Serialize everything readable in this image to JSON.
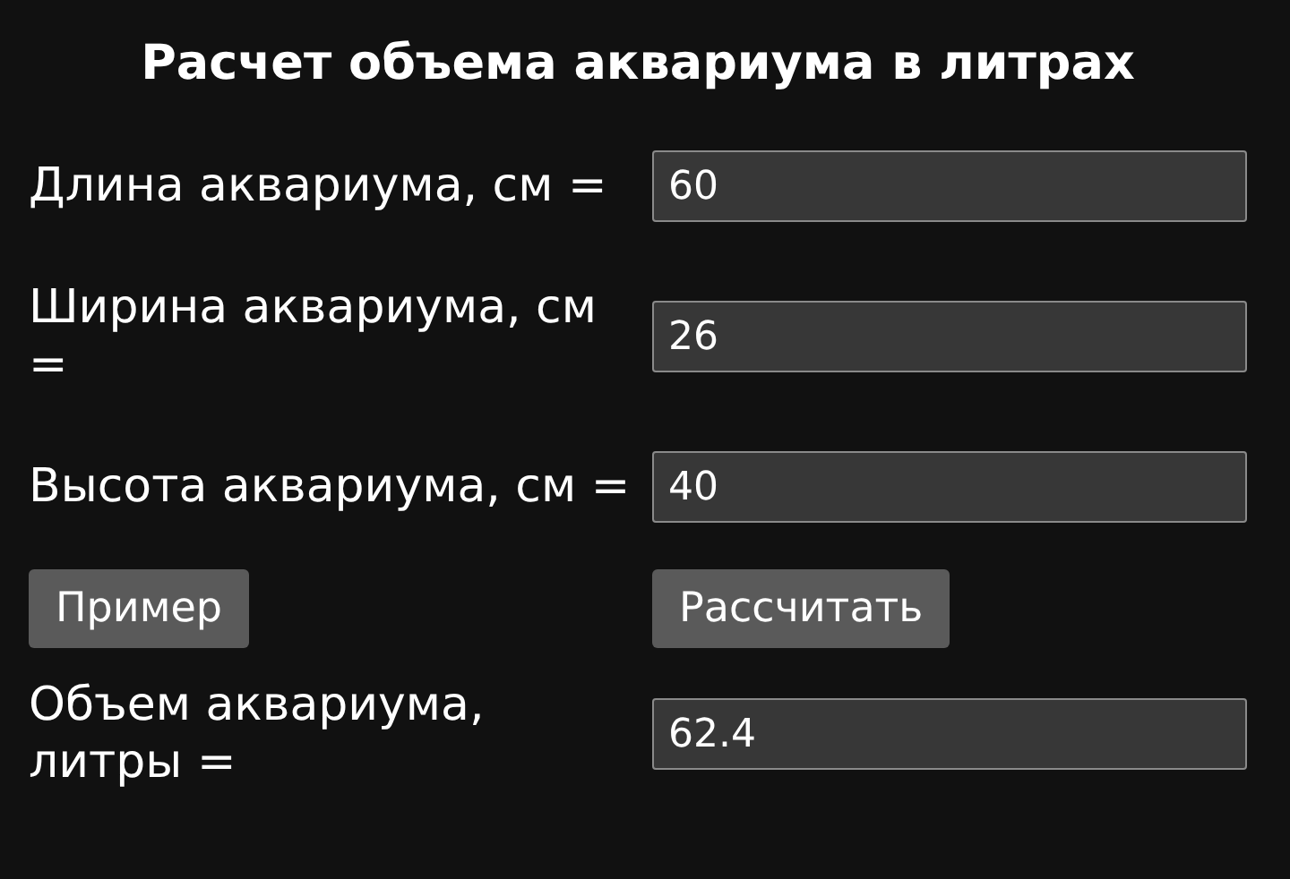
{
  "title": "Расчет объема аквариума в литрах",
  "fields": [
    {
      "label": "Длина аквариума, см =",
      "value": "60"
    },
    {
      "label": "Ширина аквариума, см =",
      "value": "26"
    },
    {
      "label": "Высота аквариума, см =",
      "value": "40"
    }
  ],
  "buttons": [
    "Пример",
    "Рассчитать"
  ],
  "result": {
    "label": "Объем аквариума, литры =",
    "value": "62.4"
  }
}
